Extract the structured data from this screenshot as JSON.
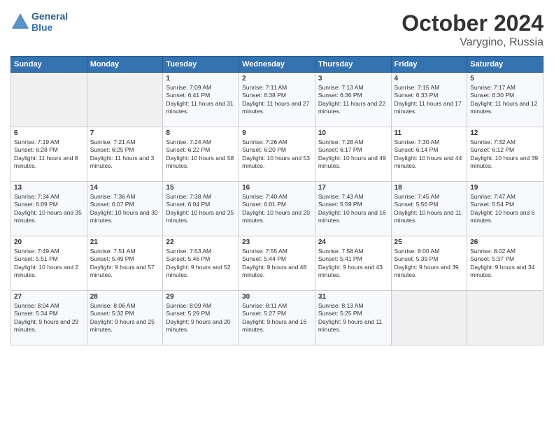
{
  "header": {
    "logo_line1": "General",
    "logo_line2": "Blue",
    "month": "October 2024",
    "location": "Varygino, Russia"
  },
  "weekdays": [
    "Sunday",
    "Monday",
    "Tuesday",
    "Wednesday",
    "Thursday",
    "Friday",
    "Saturday"
  ],
  "rows": [
    [
      {
        "day": "",
        "sunrise": "",
        "sunset": "",
        "daylight": ""
      },
      {
        "day": "",
        "sunrise": "",
        "sunset": "",
        "daylight": ""
      },
      {
        "day": "1",
        "sunrise": "Sunrise: 7:09 AM",
        "sunset": "Sunset: 6:41 PM",
        "daylight": "Daylight: 11 hours and 31 minutes."
      },
      {
        "day": "2",
        "sunrise": "Sunrise: 7:11 AM",
        "sunset": "Sunset: 6:38 PM",
        "daylight": "Daylight: 11 hours and 27 minutes."
      },
      {
        "day": "3",
        "sunrise": "Sunrise: 7:13 AM",
        "sunset": "Sunset: 6:36 PM",
        "daylight": "Daylight: 11 hours and 22 minutes."
      },
      {
        "day": "4",
        "sunrise": "Sunrise: 7:15 AM",
        "sunset": "Sunset: 6:33 PM",
        "daylight": "Daylight: 11 hours and 17 minutes."
      },
      {
        "day": "5",
        "sunrise": "Sunrise: 7:17 AM",
        "sunset": "Sunset: 6:30 PM",
        "daylight": "Daylight: 11 hours and 12 minutes."
      }
    ],
    [
      {
        "day": "6",
        "sunrise": "Sunrise: 7:19 AM",
        "sunset": "Sunset: 6:28 PM",
        "daylight": "Daylight: 11 hours and 8 minutes."
      },
      {
        "day": "7",
        "sunrise": "Sunrise: 7:21 AM",
        "sunset": "Sunset: 6:25 PM",
        "daylight": "Daylight: 11 hours and 3 minutes."
      },
      {
        "day": "8",
        "sunrise": "Sunrise: 7:24 AM",
        "sunset": "Sunset: 6:22 PM",
        "daylight": "Daylight: 10 hours and 58 minutes."
      },
      {
        "day": "9",
        "sunrise": "Sunrise: 7:26 AM",
        "sunset": "Sunset: 6:20 PM",
        "daylight": "Daylight: 10 hours and 53 minutes."
      },
      {
        "day": "10",
        "sunrise": "Sunrise: 7:28 AM",
        "sunset": "Sunset: 6:17 PM",
        "daylight": "Daylight: 10 hours and 49 minutes."
      },
      {
        "day": "11",
        "sunrise": "Sunrise: 7:30 AM",
        "sunset": "Sunset: 6:14 PM",
        "daylight": "Daylight: 10 hours and 44 minutes."
      },
      {
        "day": "12",
        "sunrise": "Sunrise: 7:32 AM",
        "sunset": "Sunset: 6:12 PM",
        "daylight": "Daylight: 10 hours and 39 minutes."
      }
    ],
    [
      {
        "day": "13",
        "sunrise": "Sunrise: 7:34 AM",
        "sunset": "Sunset: 6:09 PM",
        "daylight": "Daylight: 10 hours and 35 minutes."
      },
      {
        "day": "14",
        "sunrise": "Sunrise: 7:36 AM",
        "sunset": "Sunset: 6:07 PM",
        "daylight": "Daylight: 10 hours and 30 minutes."
      },
      {
        "day": "15",
        "sunrise": "Sunrise: 7:38 AM",
        "sunset": "Sunset: 6:04 PM",
        "daylight": "Daylight: 10 hours and 25 minutes."
      },
      {
        "day": "16",
        "sunrise": "Sunrise: 7:40 AM",
        "sunset": "Sunset: 6:01 PM",
        "daylight": "Daylight: 10 hours and 20 minutes."
      },
      {
        "day": "17",
        "sunrise": "Sunrise: 7:43 AM",
        "sunset": "Sunset: 5:59 PM",
        "daylight": "Daylight: 10 hours and 16 minutes."
      },
      {
        "day": "18",
        "sunrise": "Sunrise: 7:45 AM",
        "sunset": "Sunset: 5:56 PM",
        "daylight": "Daylight: 10 hours and 11 minutes."
      },
      {
        "day": "19",
        "sunrise": "Sunrise: 7:47 AM",
        "sunset": "Sunset: 5:54 PM",
        "daylight": "Daylight: 10 hours and 6 minutes."
      }
    ],
    [
      {
        "day": "20",
        "sunrise": "Sunrise: 7:49 AM",
        "sunset": "Sunset: 5:51 PM",
        "daylight": "Daylight: 10 hours and 2 minutes."
      },
      {
        "day": "21",
        "sunrise": "Sunrise: 7:51 AM",
        "sunset": "Sunset: 5:49 PM",
        "daylight": "Daylight: 9 hours and 57 minutes."
      },
      {
        "day": "22",
        "sunrise": "Sunrise: 7:53 AM",
        "sunset": "Sunset: 5:46 PM",
        "daylight": "Daylight: 9 hours and 52 minutes."
      },
      {
        "day": "23",
        "sunrise": "Sunrise: 7:55 AM",
        "sunset": "Sunset: 5:44 PM",
        "daylight": "Daylight: 9 hours and 48 minutes."
      },
      {
        "day": "24",
        "sunrise": "Sunrise: 7:58 AM",
        "sunset": "Sunset: 5:41 PM",
        "daylight": "Daylight: 9 hours and 43 minutes."
      },
      {
        "day": "25",
        "sunrise": "Sunrise: 8:00 AM",
        "sunset": "Sunset: 5:39 PM",
        "daylight": "Daylight: 9 hours and 39 minutes."
      },
      {
        "day": "26",
        "sunrise": "Sunrise: 8:02 AM",
        "sunset": "Sunset: 5:37 PM",
        "daylight": "Daylight: 9 hours and 34 minutes."
      }
    ],
    [
      {
        "day": "27",
        "sunrise": "Sunrise: 8:04 AM",
        "sunset": "Sunset: 5:34 PM",
        "daylight": "Daylight: 9 hours and 29 minutes."
      },
      {
        "day": "28",
        "sunrise": "Sunrise: 8:06 AM",
        "sunset": "Sunset: 5:32 PM",
        "daylight": "Daylight: 9 hours and 25 minutes."
      },
      {
        "day": "29",
        "sunrise": "Sunrise: 8:09 AM",
        "sunset": "Sunset: 5:29 PM",
        "daylight": "Daylight: 9 hours and 20 minutes."
      },
      {
        "day": "30",
        "sunrise": "Sunrise: 8:11 AM",
        "sunset": "Sunset: 5:27 PM",
        "daylight": "Daylight: 9 hours and 16 minutes."
      },
      {
        "day": "31",
        "sunrise": "Sunrise: 8:13 AM",
        "sunset": "Sunset: 5:25 PM",
        "daylight": "Daylight: 9 hours and 11 minutes."
      },
      {
        "day": "",
        "sunrise": "",
        "sunset": "",
        "daylight": ""
      },
      {
        "day": "",
        "sunrise": "",
        "sunset": "",
        "daylight": ""
      }
    ]
  ]
}
